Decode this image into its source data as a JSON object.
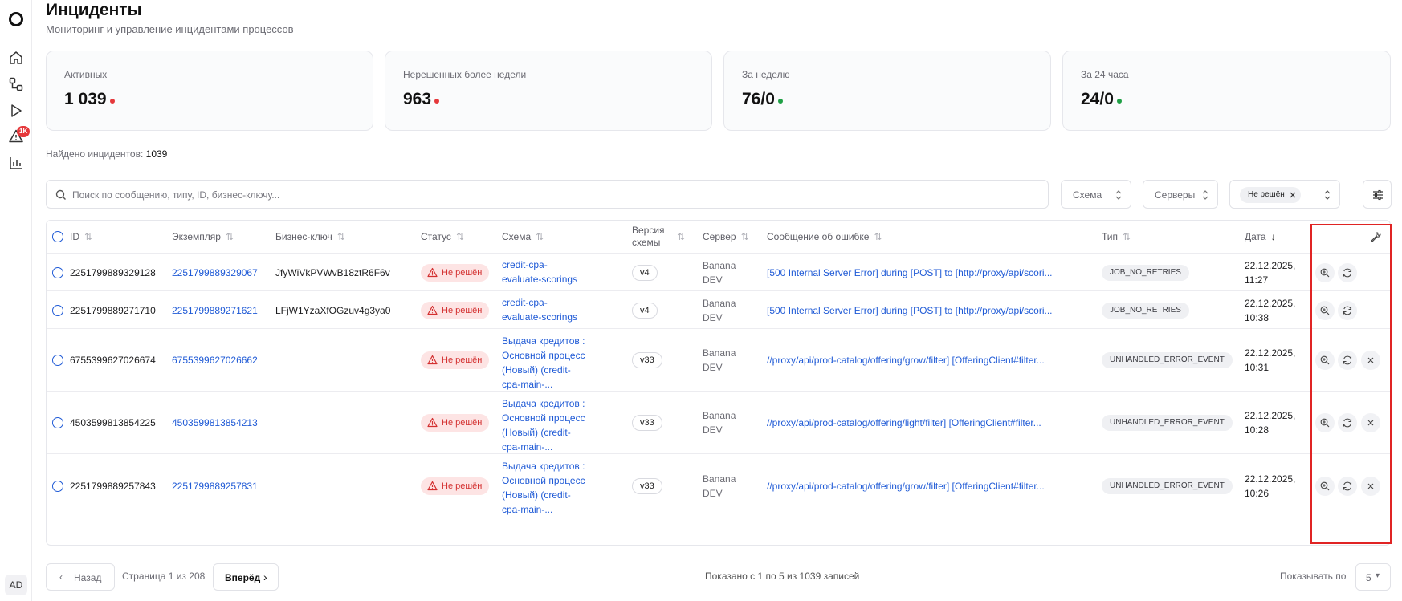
{
  "page": {
    "title": "Инциденты",
    "subtitle": "Мониторинг и управление инцидентами процессов"
  },
  "sidebar": {
    "badge": "1K",
    "avatar": "AD"
  },
  "stats": [
    {
      "label": "Активных",
      "value": "1 039",
      "dot_color": "#e5383b"
    },
    {
      "label": "Нерешенных более недели",
      "value": "963",
      "dot_color": "#e5383b"
    },
    {
      "label": "За неделю",
      "value": "76/0",
      "dot_color": "#1fa045"
    },
    {
      "label": "За 24 часа",
      "value": "24/0",
      "dot_color": "#1fa045"
    }
  ],
  "found": {
    "label": "Найдено инцидентов:",
    "count": "1039"
  },
  "search": {
    "placeholder": "Поиск по сообщению, типу, ID, бизнес-ключу..."
  },
  "filters": {
    "schema": "Схема",
    "servers": "Серверы",
    "status_chip": "Не решён"
  },
  "table": {
    "headers": {
      "id": "ID",
      "instance": "Экземпляр",
      "bkey": "Бизнес-ключ",
      "status": "Статус",
      "schema": "Схема",
      "version": "Версия схемы",
      "server": "Сервер",
      "error": "Сообщение об ошибке",
      "type": "Тип",
      "date": "Дата"
    },
    "rows": [
      {
        "id": "2251799889329128",
        "instance": "2251799889329067",
        "bkey": "JfyWiVkPVWvB18ztR6F6v",
        "status": "Не решён",
        "schema": "credit-cpa-evaluate-scorings",
        "version": "v4",
        "server": "Banana DEV",
        "error": "[500 Internal Server Error] during [POST] to [http://proxy/api/scori...",
        "type": "JOB_NO_RETRIES",
        "date": "22.12.2025, 11:27"
      },
      {
        "id": "2251799889271710",
        "instance": "2251799889271621",
        "bkey": "LFjW1YzaXfOGzuv4g3ya0",
        "status": "Не решён",
        "schema": "credit-cpa-evaluate-scorings",
        "version": "v4",
        "server": "Banana DEV",
        "error": "[500 Internal Server Error] during [POST] to [http://proxy/api/scori...",
        "type": "JOB_NO_RETRIES",
        "date": "22.12.2025, 10:38"
      },
      {
        "id": "6755399627026674",
        "instance": "6755399627026662",
        "bkey": "",
        "status": "Не решён",
        "schema": "Выдача кредитов : Основной процесс (Новый) (credit-cpa-main-...",
        "version": "v33",
        "server": "Banana DEV",
        "error": "//proxy/api/prod-catalog/offering/grow/filter] [OfferingClient#filter...",
        "type": "UNHANDLED_ERROR_EVENT",
        "date": "22.12.2025, 10:31"
      },
      {
        "id": "4503599813854225",
        "instance": "4503599813854213",
        "bkey": "",
        "status": "Не решён",
        "schema": "Выдача кредитов : Основной процесс (Новый) (credit-cpa-main-...",
        "version": "v33",
        "server": "Banana DEV",
        "error": "//proxy/api/prod-catalog/offering/light/filter] [OfferingClient#filter...",
        "type": "UNHANDLED_ERROR_EVENT",
        "date": "22.12.2025, 10:28"
      },
      {
        "id": "2251799889257843",
        "instance": "2251799889257831",
        "bkey": "",
        "status": "Не решён",
        "schema": "Выдача кредитов : Основной процесс (Новый) (credit-cpa-main-...",
        "version": "v33",
        "server": "Banana DEV",
        "error": "//proxy/api/prod-catalog/offering/grow/filter] [OfferingClient#filter...",
        "type": "UNHANDLED_ERROR_EVENT",
        "date": "22.12.2025, 10:26"
      }
    ]
  },
  "pagination": {
    "prev": "Назад",
    "page_info": "Страница 1 из 208",
    "next": "Вперёд",
    "shown": "Показано с 1 по 5 из 1039 записей",
    "per_page_label": "Показывать по",
    "per_page_value": "5"
  }
}
